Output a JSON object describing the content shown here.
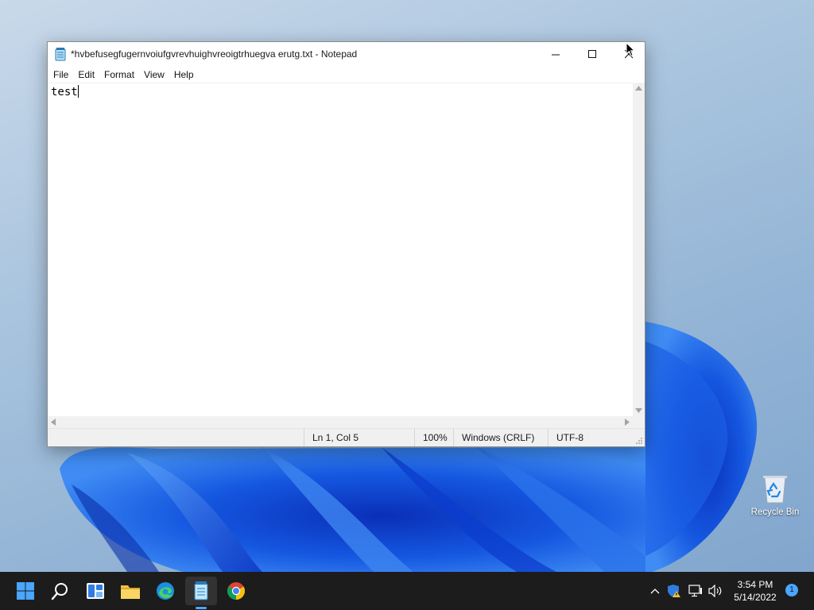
{
  "desktop": {
    "icons": [
      {
        "label": "Recycle Bin",
        "icon": "recycle-bin-icon"
      }
    ]
  },
  "notepad": {
    "title": "*hvbefusegfugernvoiufgvrevhuighvreoigtrhuegva erutg.txt - Notepad",
    "menu": [
      "File",
      "Edit",
      "Format",
      "View",
      "Help"
    ],
    "content": "test",
    "status": {
      "position": "Ln 1, Col 5",
      "zoom": "100%",
      "line_endings": "Windows (CRLF)",
      "encoding": "UTF-8"
    }
  },
  "taskbar": {
    "apps": [
      "start-icon",
      "search-icon",
      "widgets-icon",
      "file-explorer-icon",
      "edge-icon",
      "notepad-icon",
      "chrome-icon"
    ],
    "active_app": "notepad-icon",
    "tray": [
      "chevron-up-icon",
      "security-warning-icon",
      "network-icon",
      "volume-icon"
    ],
    "time": "3:54 PM",
    "date": "5/14/2022",
    "notification_count": "1",
    "accent": "#4aa6ff"
  }
}
